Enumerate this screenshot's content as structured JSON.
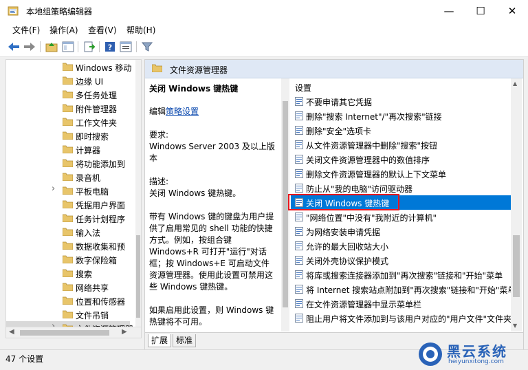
{
  "window": {
    "title": "本地组策略编辑器",
    "minimize": "—",
    "maximize": "☐",
    "close": "✕"
  },
  "menu": [
    "文件(F)",
    "操作(A)",
    "查看(V)",
    "帮助(H)"
  ],
  "toolbar": {
    "icons": [
      "back-icon",
      "forward-icon",
      "up-folder-icon",
      "show-tree-icon",
      "export-icon",
      "help-icon",
      "properties-icon",
      "filter-icon"
    ]
  },
  "tree": {
    "items": [
      {
        "label": "Windows 移动",
        "expandable": false
      },
      {
        "label": "边缘 UI",
        "expandable": false
      },
      {
        "label": "多任务处理",
        "expandable": false
      },
      {
        "label": "附件管理器",
        "expandable": false
      },
      {
        "label": "工作文件夹",
        "expandable": false
      },
      {
        "label": "即时搜索",
        "expandable": false
      },
      {
        "label": "计算器",
        "expandable": false
      },
      {
        "label": "将功能添加到",
        "expandable": false
      },
      {
        "label": "录音机",
        "expandable": false
      },
      {
        "label": "平板电脑",
        "expandable": true
      },
      {
        "label": "凭据用户界面",
        "expandable": false
      },
      {
        "label": "任务计划程序",
        "expandable": false
      },
      {
        "label": "输入法",
        "expandable": false
      },
      {
        "label": "数据收集和预",
        "expandable": false
      },
      {
        "label": "数字保险箱",
        "expandable": false
      },
      {
        "label": "搜索",
        "expandable": false
      },
      {
        "label": "网络共享",
        "expandable": false
      },
      {
        "label": "位置和传感器",
        "expandable": false
      },
      {
        "label": "文件吊销",
        "expandable": false
      },
      {
        "label": "文件资源管理器",
        "expandable": true,
        "selected": true
      }
    ]
  },
  "right": {
    "header": "文件资源管理器",
    "description": {
      "title": "关闭 Windows 键热键",
      "edit_prefix": "编辑",
      "edit_link": "策略设置",
      "requirement_label": "要求:",
      "requirement_value": "Windows Server 2003 及以上版本",
      "desc_label": "描述:",
      "desc_value": "关闭 Windows 键热键。",
      "para1": "带有 Windows 键的键盘为用户提供了启用常见的 shell 功能的快捷方式。例如，按组合键 Windows+R 可打开\"运行\"对话框；按 Windows+E 可启动文件资源管理器。使用此设置可禁用这些 Windows 键热键。",
      "para2": "如果启用此设置，则 Windows 键热键将不可用。"
    },
    "column_header": "设置",
    "items": [
      "不要申请其它凭据",
      "删除\"搜索 Internet\"/\"再次搜索\"链接",
      "删除\"安全\"选项卡",
      "从文件资源管理器中删除\"搜索\"按钮",
      "关闭文件资源管理器中的数值排序",
      "删除文件资源管理器的默认上下文菜单",
      "防止从\"我的电脑\"访问驱动器",
      "关闭 Windows 键热键",
      "\"网络位置\"中没有\"我附近的计算机\"",
      "为网络安装申请凭据",
      "允许的最大回收站大小",
      "关闭外壳协议保护模式",
      "将库或搜索连接器添加到\"再次搜索\"链接和\"开始\"菜单",
      "将 Internet 搜索站点附加到\"再次搜索\"链接和\"开始\"菜单",
      "在文件资源管理器中显示菜单栏",
      "阻止用户将文件添加到与该用户对应的\"用户文件\"文件夹"
    ],
    "selected_index": 7,
    "tabs": [
      "扩展",
      "标准"
    ]
  },
  "status": "47 个设置",
  "watermark": {
    "title": "黑云系统",
    "subtitle": "heiyunxitong.com"
  },
  "colors": {
    "accent": "#0078d7",
    "highlight_box": "#e8171e",
    "header_bg": "#dfe8f5",
    "folder": "#e8c56a"
  }
}
